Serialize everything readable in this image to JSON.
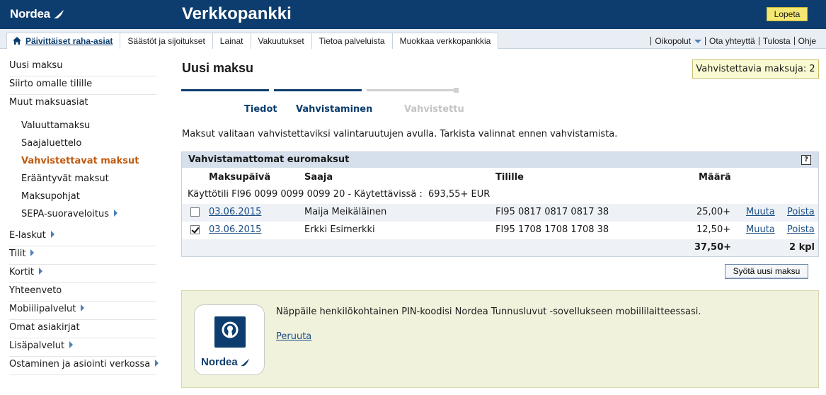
{
  "header": {
    "brand": "Nordea",
    "app_title": "Verkkopankki",
    "logout_label": "Lopeta"
  },
  "nav": {
    "tabs": [
      {
        "label": "Päivittäiset raha-asiat",
        "active": true
      },
      {
        "label": "Säästöt ja sijoitukset"
      },
      {
        "label": "Lainat"
      },
      {
        "label": "Vakuutukset"
      },
      {
        "label": "Tietoa palveluista"
      },
      {
        "label": "Muokkaa verkkopankkia"
      }
    ],
    "utility": [
      "Oikopolut",
      "Ota yhteyttä",
      "Tulosta",
      "Ohje"
    ]
  },
  "sidebar": {
    "top_items": [
      "Uusi maksu",
      "Siirto omalle tilille",
      "Muut maksuasiat"
    ],
    "sub_items": [
      "Valuuttamaksu",
      "Saajaluettelo",
      "Vahvistettavat maksut",
      "Erääntyvät maksut",
      "Maksupohjat",
      "SEPA-suoraveloitus"
    ],
    "bottom_items": [
      "E-laskut",
      "Tilit",
      "Kortit",
      "Yhteenveto",
      "Mobiilipalvelut",
      "Omat asiakirjat",
      "Lisäpalvelut",
      "Ostaminen ja asiointi verkossa"
    ]
  },
  "main": {
    "title": "Uusi maksu",
    "pending_badge": "Vahvistettavia maksuja: 2",
    "steps": [
      "Tiedot",
      "Vahvistaminen",
      "Vahvistettu"
    ],
    "info": "Maksut valitaan vahvistettaviksi valintaruutujen avulla. Tarkista valinnat ennen vahvistamista."
  },
  "table": {
    "title": "Vahvistamattomat euromaksut",
    "help": "?",
    "columns": [
      "Maksupäivä",
      "Saaja",
      "Tilille",
      "Määrä"
    ],
    "account_line": {
      "account": "Käyttötili FI96 0099 0099 0099 20  - Käytettävissä :",
      "balance": "693,55+ EUR"
    },
    "rows": [
      {
        "checked": false,
        "date": "03.06.2015",
        "payee": "Maija Meikäläinen",
        "account": "FI95 0817 0817 0817 38",
        "amount": "25,00+",
        "edit": "Muuta",
        "delete": "Poista"
      },
      {
        "checked": true,
        "date": "03.06.2015",
        "payee": "Erkki Esimerkki",
        "account": "FI95 1708 1708 1708 38",
        "amount": "12,50+",
        "edit": "Muuta",
        "delete": "Poista"
      }
    ],
    "total": "37,50+",
    "count": "2 kpl"
  },
  "new_payment_label": "Syötä uusi maksu",
  "pin": {
    "message": "Näppäile henkilökohtainen PIN-koodisi Nordea Tunnusluvut -sovellukseen mobiililaitteessasi.",
    "cancel": "Peruuta",
    "app_brand": "Nordea"
  },
  "colors": {
    "brand_navy": "#0d3d6e",
    "active_orange": "#c05a10",
    "link_blue": "#1b4e86",
    "logout_yellow": "#f4e872"
  }
}
